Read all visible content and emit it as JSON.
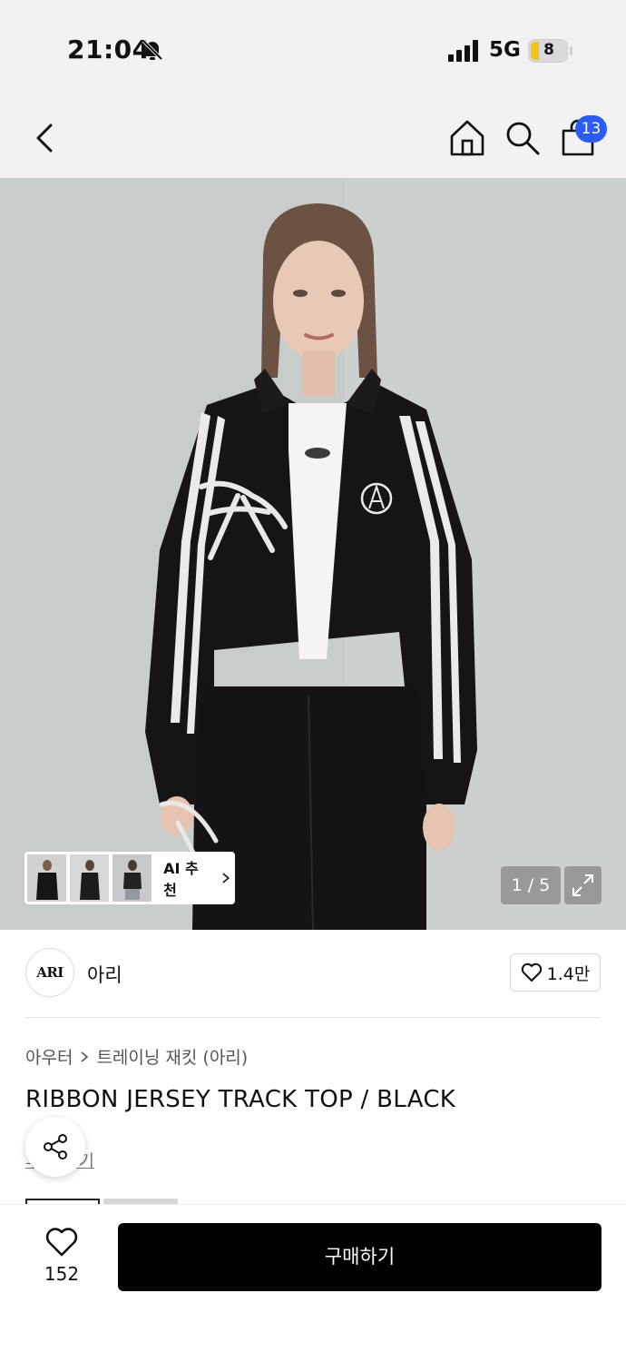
{
  "status_bar": {
    "time": "21:04",
    "network": "5G",
    "battery": "8"
  },
  "nav": {
    "cart_count": "13"
  },
  "gallery": {
    "counter": "1 / 5",
    "ai_label": "AI 추천"
  },
  "brand": {
    "logo_text": "ARI",
    "name": "아리",
    "likes": "1.4만"
  },
  "product": {
    "breadcrumb": [
      "아우터",
      "트레이닝 재킷 (아리)"
    ],
    "title": "RIBBON JERSEY TRACK TOP / BLACK",
    "link_text": "후기 보기"
  },
  "bottom": {
    "wish_count": "152",
    "buy_label": "구매하기"
  },
  "colors": {
    "badge": "#2b5cf5",
    "buy_button": "#000000"
  },
  "icons": [
    "back-icon",
    "home-icon",
    "search-icon",
    "shopping-bag-icon",
    "bell-off-icon",
    "signal-icon",
    "chevron-right-icon",
    "expand-icon",
    "heart-icon",
    "share-icon"
  ]
}
